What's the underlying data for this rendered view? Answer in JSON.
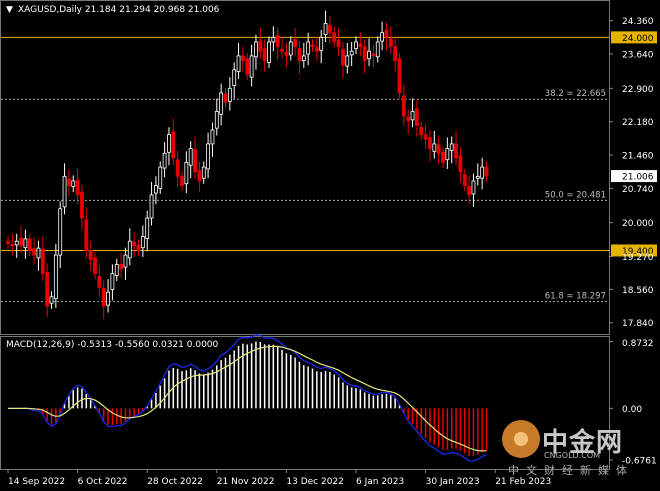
{
  "chart_data": [
    {
      "type": "candlestick",
      "title": "XAGUSD,Daily  21.184 21.294 20.968 21.006",
      "ylim": [
        17.64,
        24.72
      ],
      "y_ticks": [
        "24.360",
        "23.640",
        "22.900",
        "22.180",
        "21.460",
        "20.740",
        "20.000",
        "19.270",
        "18.560",
        "17.840"
      ],
      "y_tick_values": [
        24.36,
        23.64,
        22.9,
        22.18,
        21.46,
        20.74,
        20.0,
        19.27,
        18.56,
        17.84
      ],
      "x_ticks": [
        "14 Sep 2022",
        "6 Oct 2022",
        "28 Oct 2022",
        "21 Nov 2022",
        "13 Dec 2022",
        "6 Jan 2023",
        "30 Jan 2023",
        "21 Feb 2023"
      ],
      "x_tick_index": [
        0,
        16,
        32,
        48,
        64,
        80,
        96,
        112
      ],
      "levels": [
        {
          "label": "24.000",
          "value": 24.0,
          "color": "#e6b400"
        },
        {
          "label": "19.400",
          "value": 19.4,
          "color": "#e6b400"
        }
      ],
      "fib": [
        {
          "label": "38.2 = 22.665",
          "value": 22.665
        },
        {
          "label": "50.0 = 20.481",
          "value": 20.481
        },
        {
          "label": "61.8 = 18.297",
          "value": 18.297
        }
      ],
      "current_price_label": "21.006",
      "candle_up_color": "#ffffff",
      "candle_down_color": "#e60000",
      "close": [
        19.55,
        19.5,
        19.6,
        19.5,
        19.65,
        19.4,
        19.3,
        19.45,
        18.9,
        18.2,
        18.4,
        19.3,
        20.3,
        21.0,
        20.8,
        20.9,
        20.6,
        20.1,
        19.4,
        19.2,
        18.9,
        18.6,
        18.2,
        18.5,
        18.9,
        19.1,
        19.0,
        19.3,
        19.6,
        19.5,
        19.4,
        19.7,
        20.1,
        20.6,
        20.8,
        21.2,
        21.5,
        21.9,
        21.4,
        21.0,
        20.8,
        21.3,
        21.6,
        21.1,
        20.9,
        21.2,
        21.7,
        22.0,
        22.4,
        22.8,
        22.6,
        22.9,
        23.3,
        23.6,
        23.5,
        23.2,
        23.6,
        23.9,
        23.7,
        23.5,
        23.9,
        24.0,
        23.8,
        23.7,
        23.6,
        23.9,
        23.8,
        23.5,
        23.6,
        23.9,
        23.8,
        23.7,
        24.0,
        24.3,
        24.1,
        23.9,
        23.8,
        23.4,
        23.6,
        23.7,
        23.9,
        23.8,
        23.5,
        23.7,
        23.6,
        23.9,
        24.1,
        24.0,
        23.8,
        23.5,
        22.8,
        22.3,
        22.2,
        22.4,
        22.1,
        21.9,
        21.8,
        21.6,
        21.7,
        21.5,
        21.3,
        21.6,
        21.7,
        21.4,
        21.1,
        20.8,
        20.6,
        20.9,
        21.0,
        21.2,
        21.006
      ],
      "macd": {
        "label": "MACD(12,26,9) -0.5313 -0.5560 0.0321 0.0000",
        "ylim": [
          -0.78,
          0.92
        ],
        "y_ticks": [
          "0.8732",
          "0.00",
          "-0.6761"
        ],
        "y_tick_values": [
          0.8732,
          0.0,
          -0.6761
        ],
        "histogram_color": "#ffffff",
        "histogram_negative_color": "#e60000",
        "signal_color": "#e6e67a",
        "macd_line_color": "#1a2bff"
      }
    }
  ],
  "watermark": {
    "brand_cn": "中金网",
    "brand_en": "CNGOLD.COM",
    "sub_cn": "中文财经新媒体"
  }
}
